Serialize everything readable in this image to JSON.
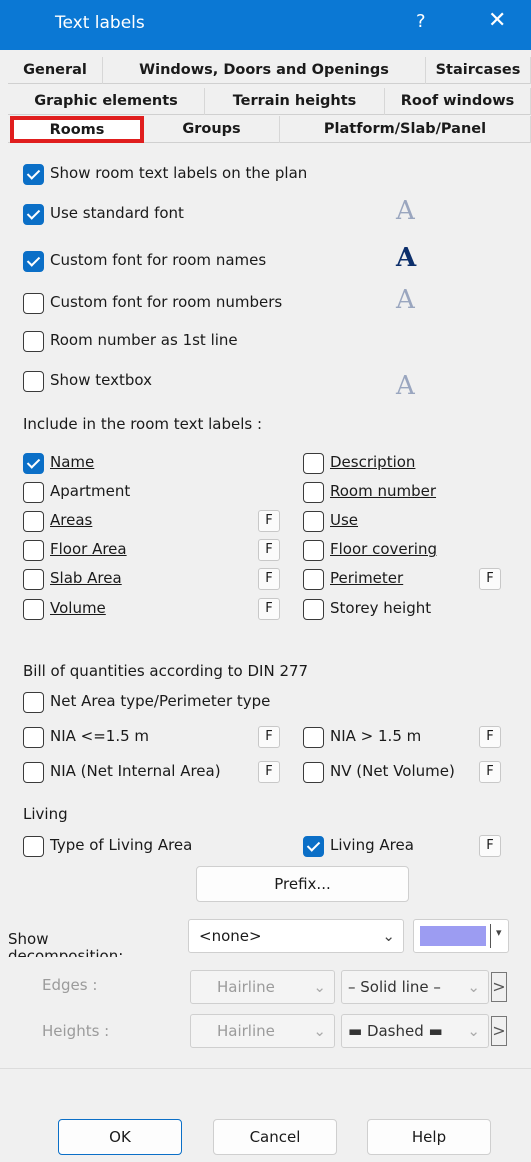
{
  "window": {
    "title": "Text labels",
    "help_glyph": "?",
    "close_glyph": "✕"
  },
  "tabs": {
    "row1": [
      "General",
      "Windows, Doors and Openings",
      "Staircases"
    ],
    "row2": [
      "Graphic elements",
      "Terrain heights",
      "Roof windows"
    ],
    "row3": [
      "Rooms",
      "Groups",
      "Platform/Slab/Panel"
    ]
  },
  "options": {
    "show_labels": "Show room text labels on the plan",
    "standard_font": "Use standard font",
    "custom_names": "Custom font for room names",
    "custom_numbers": "Custom font for room numbers",
    "room_number_first": "Room number as 1st line",
    "show_textbox": "Show textbox"
  },
  "font_glyph": "A",
  "include": {
    "heading": "Include in the room text labels :",
    "name": "Name",
    "description": "Description",
    "apartment": "Apartment",
    "room_number": "Room number",
    "areas": "Areas",
    "use": "Use",
    "floor_area": "Floor Area",
    "floor_covering": "Floor covering",
    "slab_area": "Slab Area",
    "perimeter": "Perimeter",
    "volume": "Volume",
    "storey_height": "Storey height"
  },
  "f_label": "F",
  "din": {
    "heading": "Bill of quantities according to DIN 277",
    "net_area_type": "Net Area type/Perimeter type",
    "nia_le": "NIA <=1.5 m",
    "nia_gt": "NIA > 1.5 m",
    "nia_full": "NIA (Net Internal Area)",
    "nv": "NV (Net Volume)"
  },
  "living": {
    "heading": "Living",
    "type_of_living": "Type of Living Area",
    "living_area": "Living Area"
  },
  "prefix_button": "Prefix...",
  "decomposition": {
    "label_line1": "Show",
    "label_line2": "decomposition:",
    "selected": "<none>",
    "swatch_color": "#9c9cf2",
    "edges_label": "Edges :",
    "heights_label": "Heights :",
    "edges_weight": "Hairline",
    "heights_weight": "Hairline",
    "edges_style": "– Solid line –",
    "heights_style": "▬ Dashed ▬"
  },
  "buttons": {
    "ok": "OK",
    "cancel": "Cancel",
    "help": "Help"
  },
  "colors": {
    "accent": "#0b78d4",
    "active_tab_outline": "#e01e1e"
  }
}
